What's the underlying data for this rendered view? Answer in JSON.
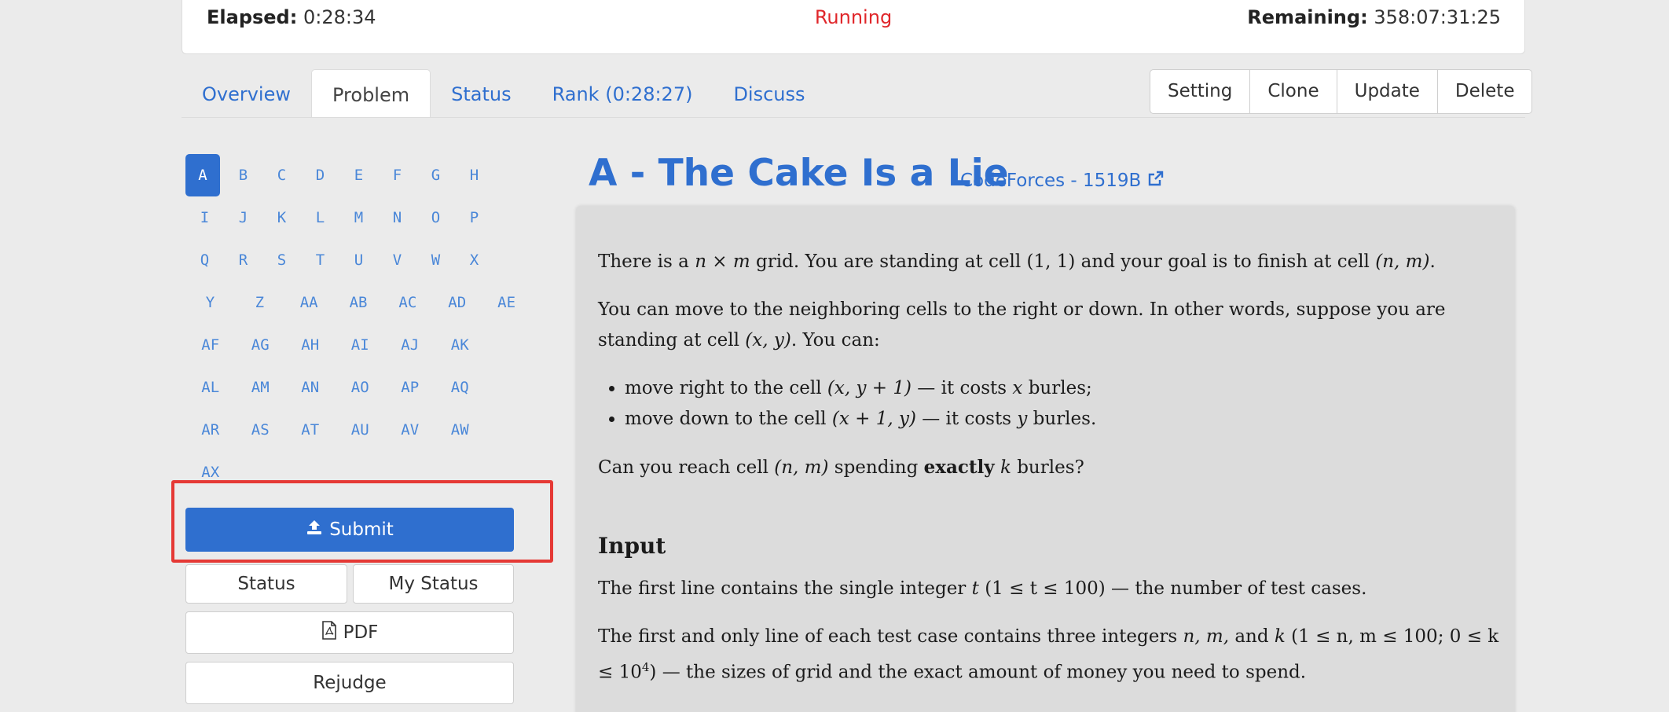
{
  "timer": {
    "elapsed_label": "Elapsed:",
    "elapsed": "0:28:34",
    "status": "Running",
    "remaining_label": "Remaining:",
    "remaining": "358:07:31:25"
  },
  "tabs": [
    {
      "label": "Overview"
    },
    {
      "label": "Problem"
    },
    {
      "label": "Status"
    },
    {
      "label": "Rank (0:28:27)"
    },
    {
      "label": "Discuss"
    }
  ],
  "actions": [
    {
      "label": "Setting"
    },
    {
      "label": "Clone"
    },
    {
      "label": "Update"
    },
    {
      "label": "Delete"
    }
  ],
  "letters": [
    [
      "A",
      "B",
      "C",
      "D",
      "E",
      "F",
      "G",
      "H"
    ],
    [
      "I",
      "J",
      "K",
      "L",
      "M",
      "N",
      "O",
      "P"
    ],
    [
      "Q",
      "R",
      "S",
      "T",
      "U",
      "V",
      "W",
      "X"
    ],
    [
      "Y",
      "Z",
      "AA",
      "AB",
      "AC",
      "AD",
      "AE"
    ],
    [
      "AF",
      "AG",
      "AH",
      "AI",
      "AJ",
      "AK"
    ],
    [
      "AL",
      "AM",
      "AN",
      "AO",
      "AP",
      "AQ"
    ],
    [
      "AR",
      "AS",
      "AT",
      "AU",
      "AV",
      "AW"
    ],
    [
      "AX"
    ]
  ],
  "active_letter": "A",
  "sidebar": {
    "submit": "Submit",
    "status": "Status",
    "my_status": "My Status",
    "pdf": "PDF",
    "rejudge": "Rejudge"
  },
  "problem": {
    "title": "A - The Cake Is a Lie",
    "source": "CodeForces - 1519B",
    "p1_a": "There is a ",
    "p1_grid": "n × m",
    "p1_b": " grid. You are standing at cell ",
    "p1_c1": "(1, 1)",
    "p1_c": " and your goal is to finish at cell ",
    "p1_c2": "(n, m)",
    "p1_end": ".",
    "p2_a": "You can move to the neighboring cells to the right or down. In other words, suppose you are standing at cell ",
    "p2_cell": "(x, y)",
    "p2_b": ". You can:",
    "li1_a": "move right to the cell ",
    "li1_cell": "(x, y + 1)",
    "li1_b": " — it costs ",
    "li1_var": "x",
    "li1_c": " burles;",
    "li2_a": "move down to the cell ",
    "li2_cell": "(x + 1, y)",
    "li2_b": " — it costs ",
    "li2_var": "y",
    "li2_c": " burles.",
    "p3_a": "Can you reach cell ",
    "p3_cell": "(n, m)",
    "p3_b": " spending ",
    "p3_bold": "exactly",
    "p3_var": "k",
    "p3_c": " burles?",
    "input_heading": "Input",
    "in1_a": "The first line contains the single integer ",
    "in1_var": "t",
    "in1_range": "(1 ≤ t ≤ 100)",
    "in1_b": " — the number of test cases.",
    "in2_a": "The first and only line of each test case contains three integers ",
    "in2_vars": "n, m,",
    "in2_and": " and ",
    "in2_k": "k",
    "in2_range": "(1 ≤ n, m ≤ 100; 0 ≤ k ≤",
    "in2_ten": "10",
    "in2_exp": "4",
    "in2_b": ") — the sizes of grid and the exact amount of money you need to spend."
  }
}
